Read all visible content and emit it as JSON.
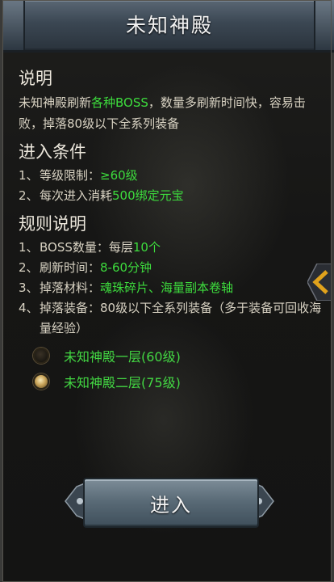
{
  "window": {
    "title": "未知神殿"
  },
  "description": {
    "heading": "说明",
    "text_before": "未知神殿刷新",
    "text_highlight": "各种BOSS",
    "text_after": "，数量多刷新时间快，容易击败，掉落80级以下全系列装备"
  },
  "conditions": {
    "heading": "进入条件",
    "items": [
      {
        "num": "1、",
        "label": "等级限制：",
        "value": "≥60级"
      },
      {
        "num": "2、",
        "label": "每次进入消耗",
        "value": "500绑定元宝"
      }
    ]
  },
  "rules": {
    "heading": "规则说明",
    "items": [
      {
        "num": "1、",
        "label": "BOSS数量：每层",
        "value": "10个"
      },
      {
        "num": "2、",
        "label": "刷新时间：",
        "value": "8-60分钟"
      },
      {
        "num": "3、",
        "label": "掉落材料：",
        "value": "魂珠碎片、海量副本卷轴"
      },
      {
        "num": "4、",
        "label": "掉落装备：80级以下全系列装备（多于装备可回收海量经验）",
        "value": ""
      }
    ]
  },
  "floors": [
    {
      "label": "未知神殿一层(60级)",
      "selected": false
    },
    {
      "label": "未知神殿二层(75级)",
      "selected": true
    }
  ],
  "enter_button": {
    "label": "进入"
  },
  "colors": {
    "highlight": "#3ddc3d",
    "text": "#d9d3c3",
    "heading": "#ece7dc",
    "title_bar": "#3b4753"
  },
  "icons": {
    "side_tab": "chevron-left-icon",
    "radio": "radio-orb-icon"
  }
}
